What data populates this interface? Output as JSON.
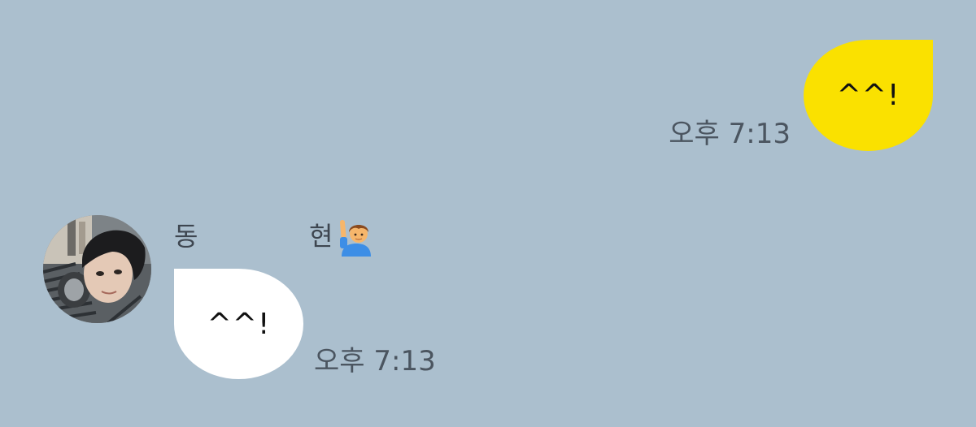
{
  "chat": {
    "outgoing": {
      "text": "^^!",
      "time": "오후 7:13",
      "bubble_color": "#fae100"
    },
    "incoming": {
      "sender": {
        "name_first": "동",
        "name_last": "현",
        "name_emoji": "man-raising-hand-emoji",
        "avatar": "profile-photo"
      },
      "text": "^^!",
      "time": "오후 7:13",
      "bubble_color": "#ffffff"
    },
    "background_color": "#abbfce"
  }
}
